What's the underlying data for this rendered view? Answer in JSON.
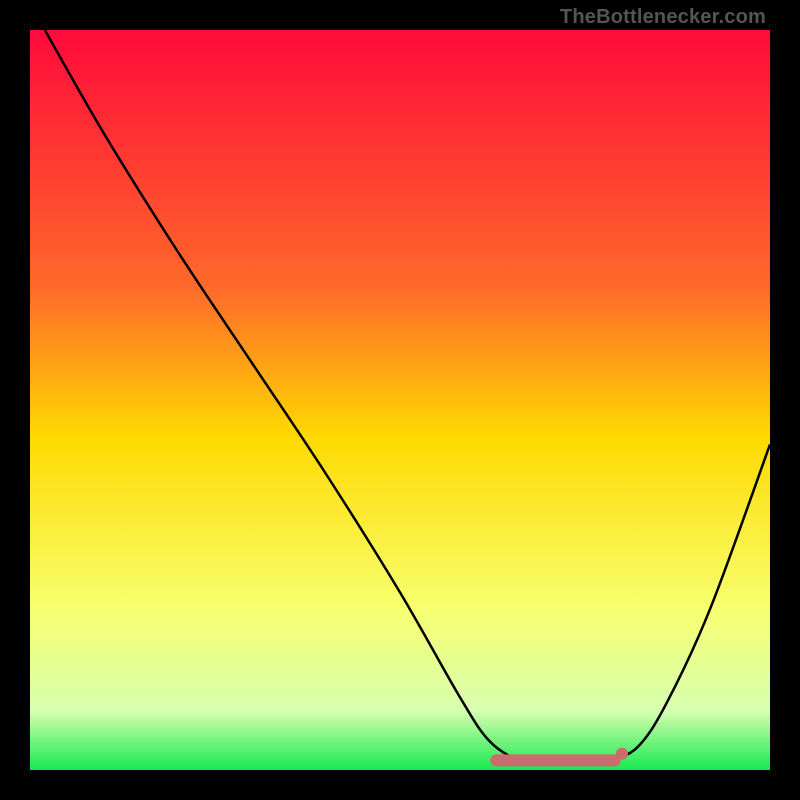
{
  "attribution": "TheBottlenecker.com",
  "chart_data": {
    "type": "line",
    "title": "",
    "xlabel": "",
    "ylabel": "",
    "xlim": [
      0,
      100
    ],
    "ylim": [
      0,
      100
    ],
    "gradient_stops": [
      {
        "offset": 0,
        "color": "#ff0a3a"
      },
      {
        "offset": 35,
        "color": "#ff6a2a"
      },
      {
        "offset": 55,
        "color": "#ffd900"
      },
      {
        "offset": 78,
        "color": "#f7ff6e"
      },
      {
        "offset": 92,
        "color": "#d7ffb0"
      },
      {
        "offset": 100,
        "color": "#17e84f"
      }
    ],
    "series": [
      {
        "name": "bottleneck-curve",
        "stroke": "#000000",
        "points": [
          {
            "x": 2,
            "y": 100
          },
          {
            "x": 10,
            "y": 86
          },
          {
            "x": 20,
            "y": 70
          },
          {
            "x": 30,
            "y": 55
          },
          {
            "x": 40,
            "y": 40
          },
          {
            "x": 50,
            "y": 24
          },
          {
            "x": 58,
            "y": 10
          },
          {
            "x": 62,
            "y": 4
          },
          {
            "x": 66,
            "y": 1.4
          },
          {
            "x": 70,
            "y": 1.2
          },
          {
            "x": 74,
            "y": 1.2
          },
          {
            "x": 78,
            "y": 1.4
          },
          {
            "x": 82,
            "y": 3
          },
          {
            "x": 86,
            "y": 9
          },
          {
            "x": 92,
            "y": 22
          },
          {
            "x": 100,
            "y": 44
          }
        ]
      }
    ],
    "flat_segment": {
      "color": "#cc6b6b",
      "thickness": 12,
      "x_start": 63,
      "x_end": 79,
      "y": 1.3,
      "end_dot_x": 80,
      "end_dot_y": 2.2,
      "end_dot_r": 6
    }
  }
}
